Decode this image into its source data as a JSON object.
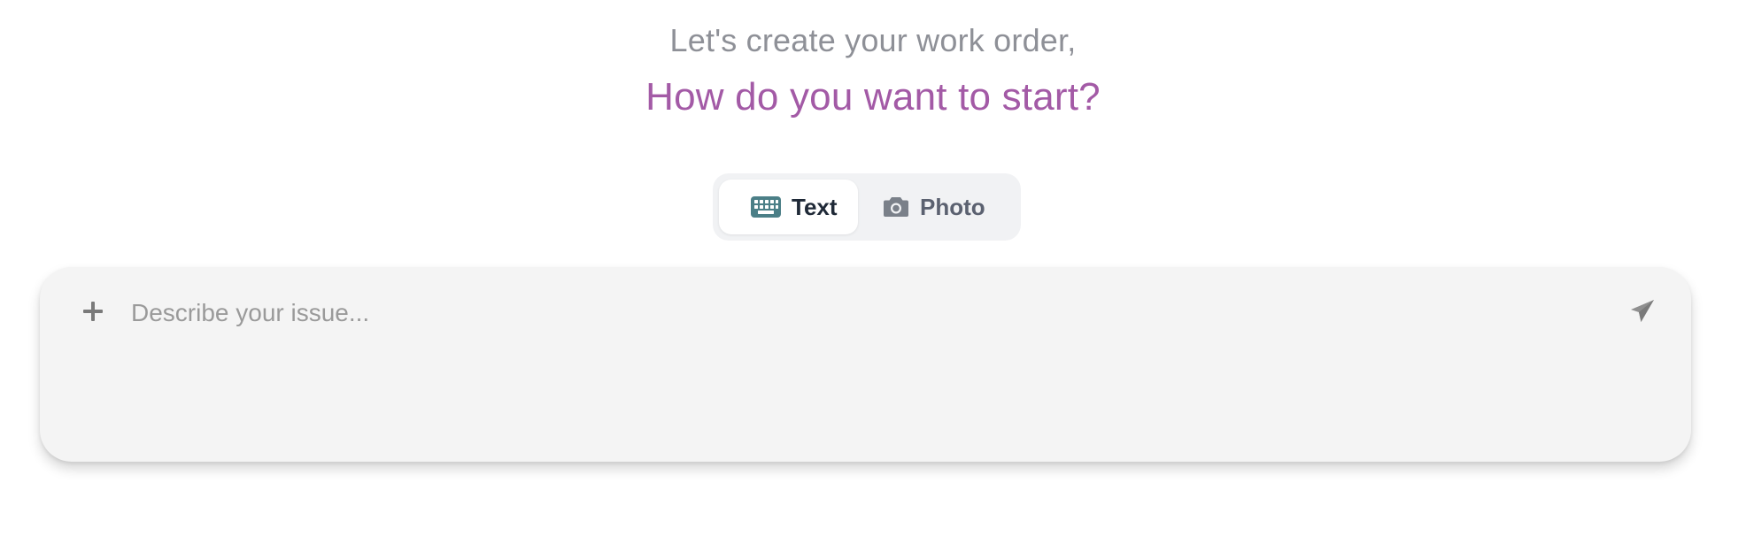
{
  "header": {
    "greeting": "Let's create your work order,",
    "prompt": "How do you want to start?"
  },
  "mode_toggle": {
    "options": [
      {
        "label": "Text",
        "icon": "keyboard-icon",
        "selected": true
      },
      {
        "label": "Photo",
        "icon": "camera-icon",
        "selected": false
      }
    ]
  },
  "composer": {
    "value": "",
    "placeholder": "Describe your issue...",
    "attach_icon": "plus-icon",
    "send_icon": "send-icon"
  },
  "colors": {
    "accent": "#a35aa6",
    "greeting_text": "#8e9097",
    "keyboard_icon": "#4b7f87",
    "composer_bg": "#f4f4f4",
    "toggle_bg": "#f1f2f4"
  }
}
